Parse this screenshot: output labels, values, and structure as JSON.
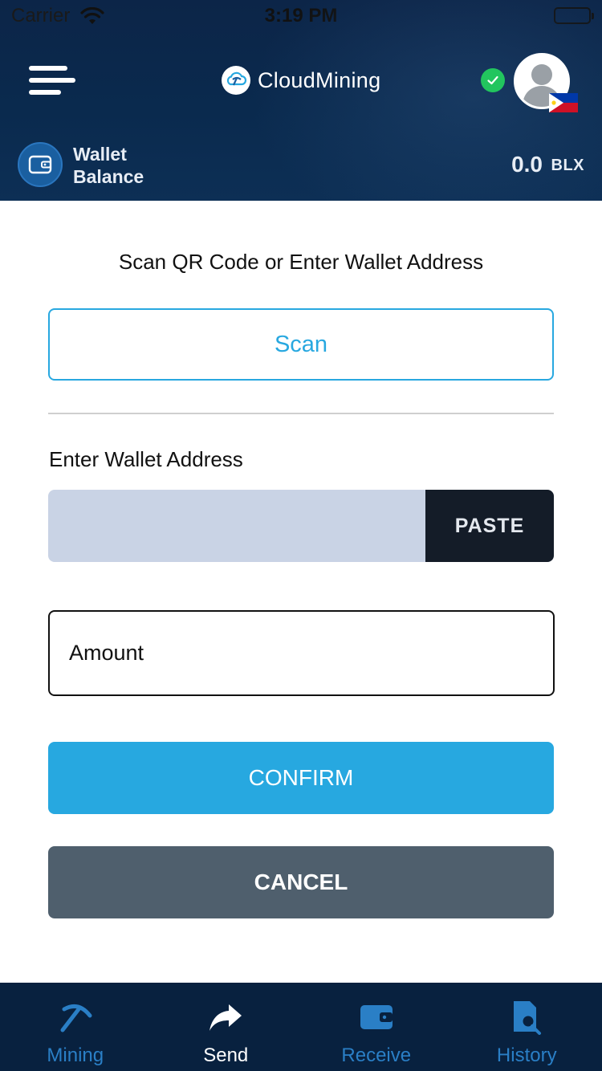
{
  "status_bar": {
    "carrier": "Carrier",
    "time": "3:19 PM"
  },
  "header": {
    "brand_name": "CloudMining",
    "menu_icon": "hamburger-menu-icon",
    "verified_icon": "check-circle-icon",
    "avatar_icon": "user-avatar-icon",
    "flag_icon": "philippines-flag-icon"
  },
  "wallet": {
    "label": "Wallet Balance",
    "balance": "0.0",
    "unit": "BLX",
    "icon": "wallet-icon"
  },
  "form": {
    "instruction": "Scan QR Code or Enter Wallet Address",
    "scan_label": "Scan",
    "address_label": "Enter Wallet Address",
    "address_value": "",
    "paste_label": "PASTE",
    "amount_placeholder": "Amount",
    "confirm_label": "CONFIRM",
    "cancel_label": "CANCEL"
  },
  "tabs": [
    {
      "label": "Mining",
      "icon": "pickaxe-icon",
      "active": false
    },
    {
      "label": "Send",
      "icon": "share-arrow-icon",
      "active": true
    },
    {
      "label": "Receive",
      "icon": "wallet-icon",
      "active": false
    },
    {
      "label": "History",
      "icon": "document-search-icon",
      "active": false
    }
  ],
  "colors": {
    "accent": "#27a8e0",
    "header_bg": "#0c2548",
    "tabbar_bg": "#08213f",
    "tab_inactive": "#2a7fc6",
    "tab_active": "#ffffff",
    "cancel_bg": "#4f5f6d",
    "paste_bg": "#141c28",
    "verified": "#22c55e"
  }
}
